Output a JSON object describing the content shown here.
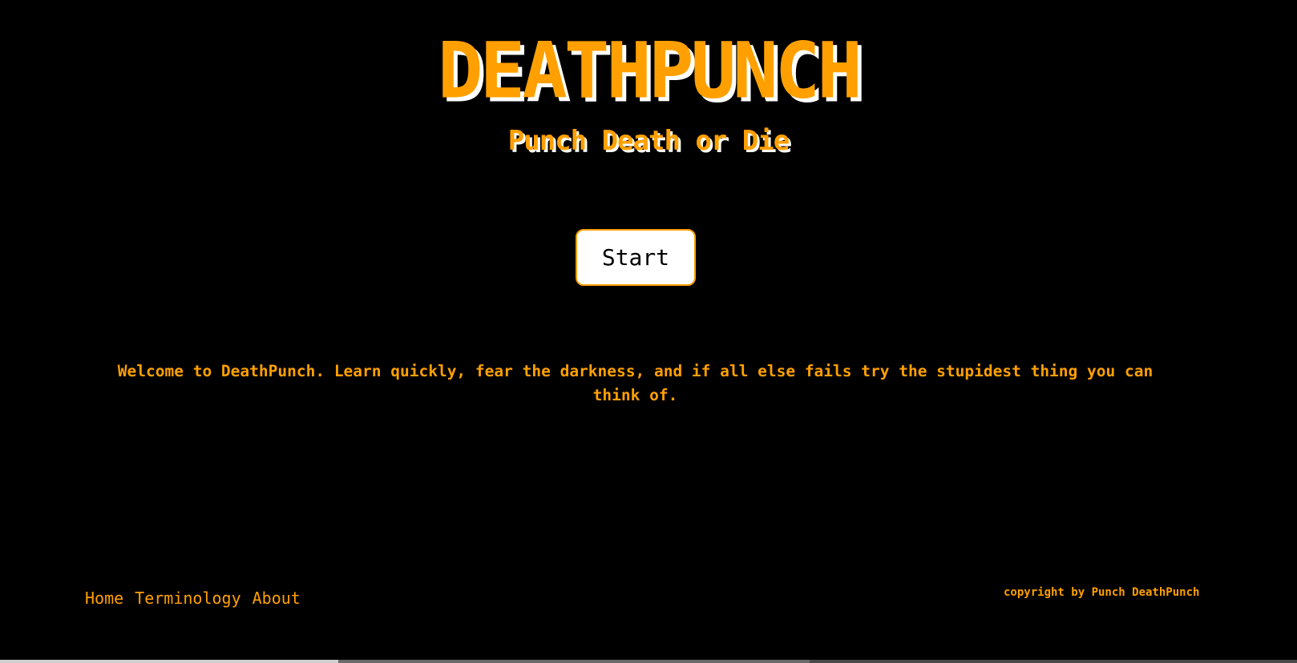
{
  "header": {
    "title": "DEATHPUNCH",
    "subtitle": "Punch Death or Die"
  },
  "main": {
    "start_label": "Start",
    "welcome_text": "Welcome to DeathPunch. Learn quickly, fear the darkness, and if all else fails try the stupidest thing you can think of."
  },
  "footer": {
    "nav": [
      {
        "label": "Home"
      },
      {
        "label": "Terminology"
      },
      {
        "label": "About"
      }
    ],
    "copyright": "copyright by Punch DeathPunch"
  },
  "colors": {
    "background": "#000000",
    "accent": "#ffa000",
    "button_bg": "#ffffff",
    "shadow": "#ffffff"
  }
}
